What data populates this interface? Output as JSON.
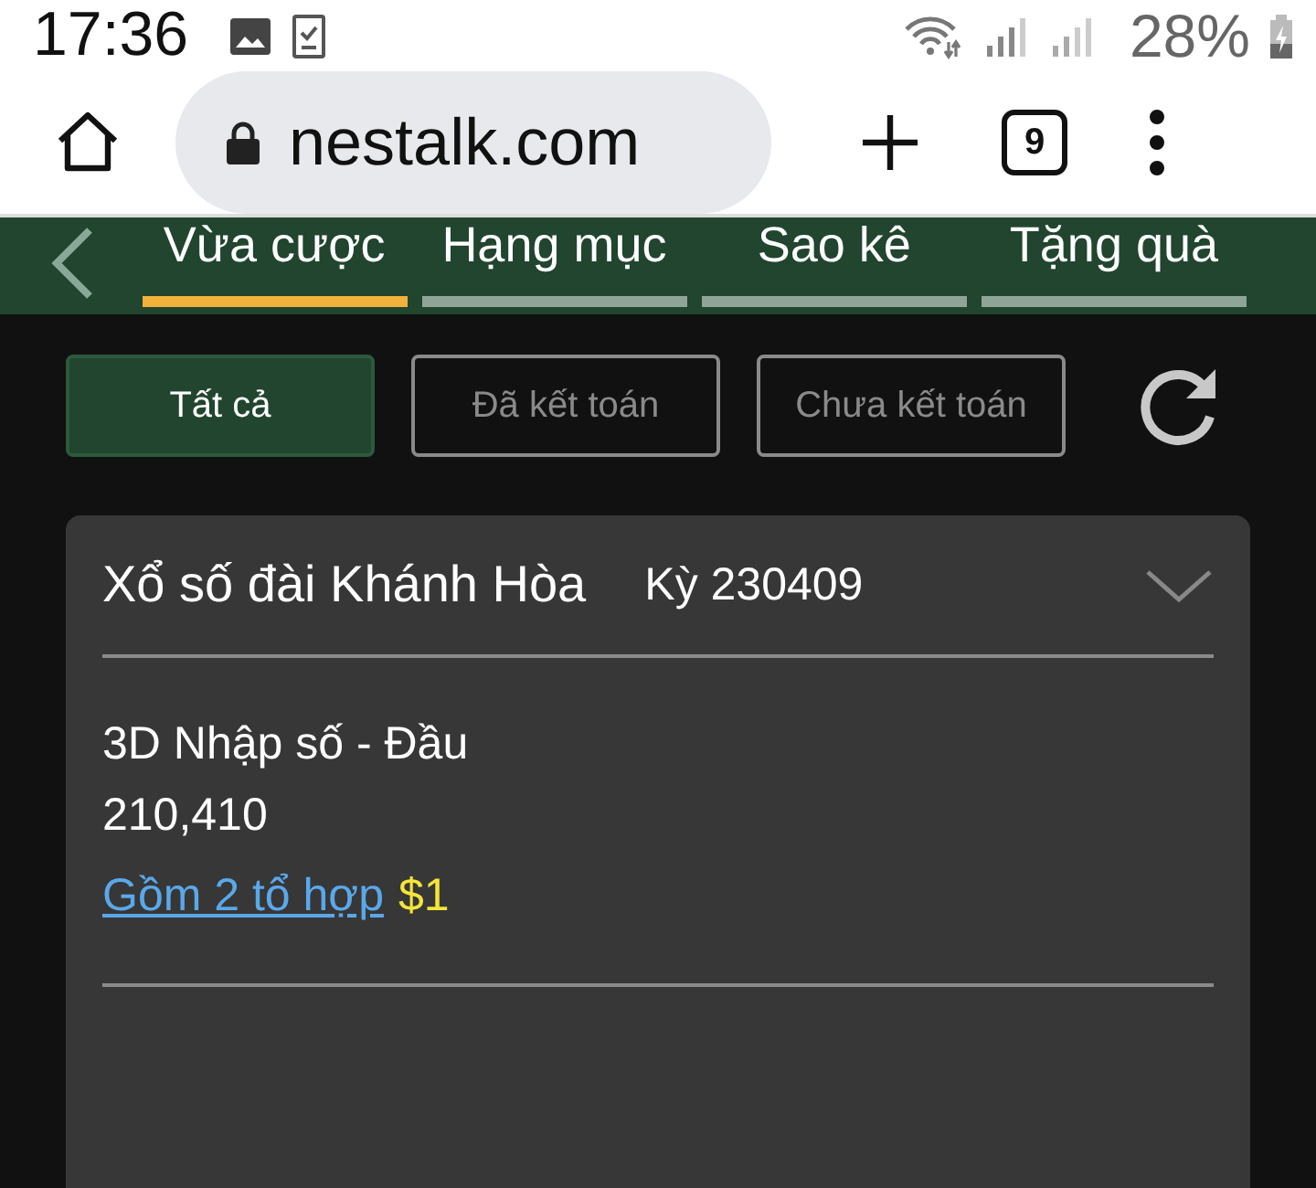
{
  "status_bar": {
    "time": "17:36",
    "battery": "28%"
  },
  "browser": {
    "url": "nestalk.com",
    "tab_count": "9"
  },
  "tabs": [
    {
      "label": "Vừa cược",
      "selected": true
    },
    {
      "label": "Hạng mục",
      "selected": false
    },
    {
      "label": "Sao kê",
      "selected": false
    },
    {
      "label": "Tặng quà",
      "selected": false
    }
  ],
  "filters": [
    {
      "label": "Tất cả",
      "selected": true
    },
    {
      "label": "Đã kết toán",
      "selected": false
    },
    {
      "label": "Chưa kết toán",
      "selected": false
    }
  ],
  "bet_card": {
    "title": "Xổ số đài Khánh Hòa",
    "period": "Kỳ 230409",
    "expanded": false,
    "bet_type": "3D Nhập số - Đầu",
    "numbers": "210,410",
    "combo_link": "Gồm 2 tổ hợp",
    "amount": "$1"
  }
}
